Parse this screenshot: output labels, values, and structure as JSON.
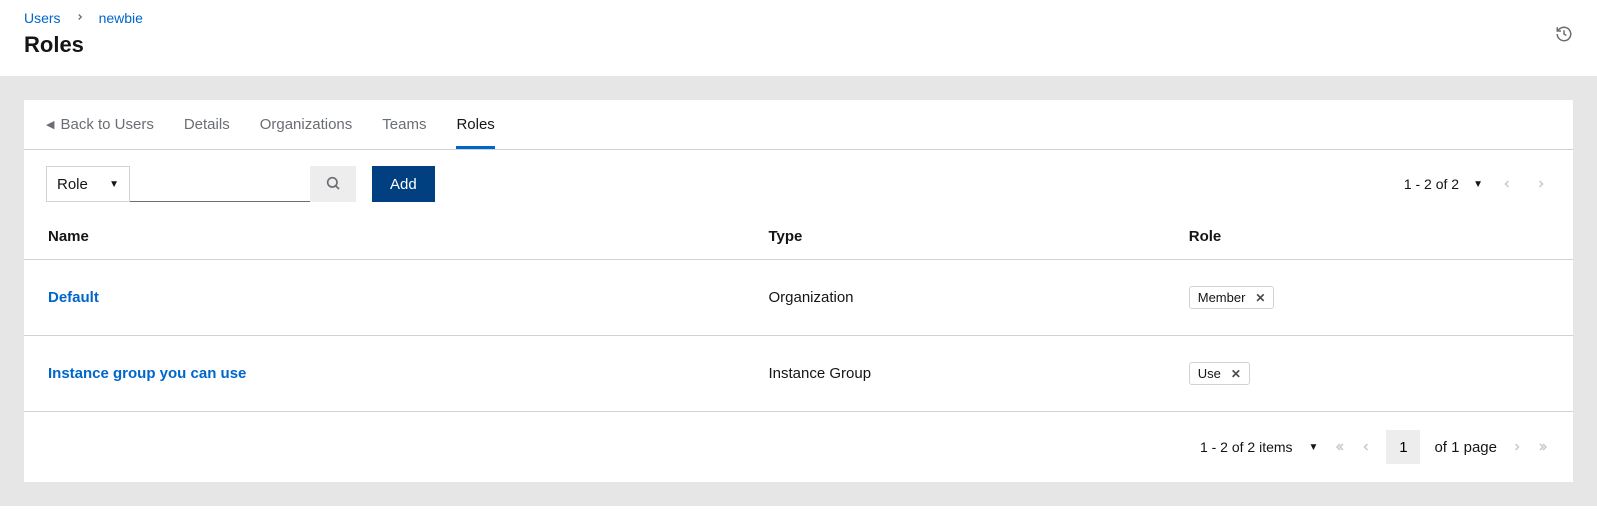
{
  "breadcrumb": {
    "parent": "Users",
    "current": "newbie"
  },
  "page_title": "Roles",
  "tabs": {
    "back": "Back to Users",
    "details": "Details",
    "organizations": "Organizations",
    "teams": "Teams",
    "roles": "Roles"
  },
  "toolbar": {
    "filter_label": "Role",
    "search_value": "",
    "add_label": "Add",
    "count_text": "1 - 2 of 2"
  },
  "table": {
    "headers": {
      "name": "Name",
      "type": "Type",
      "role": "Role"
    },
    "rows": [
      {
        "name": "Default",
        "type": "Organization",
        "role": "Member"
      },
      {
        "name": "Instance group you can use",
        "type": "Instance Group",
        "role": "Use"
      }
    ]
  },
  "pagination": {
    "items_text": "1 - 2 of 2 items",
    "page_value": "1",
    "of_page_text": "of 1 page"
  }
}
